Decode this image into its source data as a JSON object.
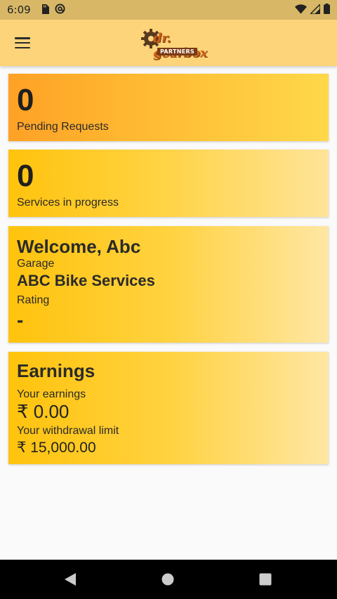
{
  "status_bar": {
    "time": "6:09",
    "icons_left": [
      "sd-card-icon",
      "at-sign-icon"
    ],
    "icons_right": [
      "wifi-icon",
      "signal-icon",
      "battery-icon"
    ]
  },
  "app_bar": {
    "menu_icon": "hamburger-menu-icon",
    "logo": {
      "text": "dr. gearbox",
      "tag": "PARTNERS"
    }
  },
  "cards": {
    "pending": {
      "count": "0",
      "label": "Pending Requests"
    },
    "progress": {
      "count": "0",
      "label": "Services in progress"
    },
    "welcome": {
      "title": "Welcome, Abc",
      "garage_label": "Garage",
      "garage_name": "ABC Bike Services",
      "rating_label": "Rating",
      "rating_value": "-"
    },
    "earnings": {
      "title": "Earnings",
      "your_earnings_label": "Your earnings",
      "your_earnings_value": "₹ 0.00",
      "withdrawal_label": "Your withdrawal limit",
      "withdrawal_value": "₹ 15,000.00"
    }
  },
  "nav_bar": {
    "icons": [
      "back-icon",
      "home-icon",
      "recent-apps-icon"
    ]
  },
  "colors": {
    "status_bar": "#d8b867",
    "app_bar": "#fdd47a",
    "card_orange": "#ffa126",
    "card_yellow": "#ffc30d",
    "background": "#fafafa",
    "nav_bar": "#000000"
  }
}
